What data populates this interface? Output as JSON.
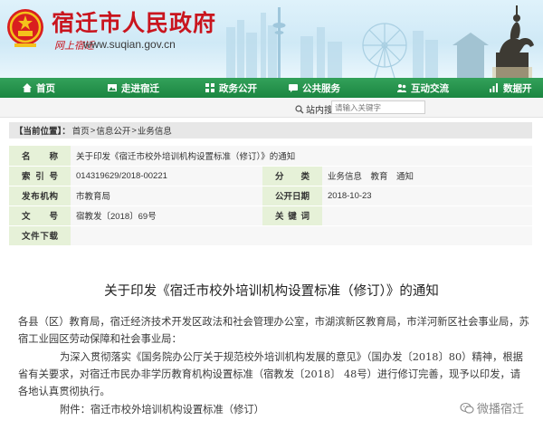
{
  "header": {
    "title": "宿迁市人民政府",
    "seal_text": "网上宿迁",
    "url": "www.suqian.gov.cn"
  },
  "nav": {
    "items": [
      {
        "label": "首页",
        "icon": "house-icon"
      },
      {
        "label": "走进宿迁",
        "icon": "picture-icon"
      },
      {
        "label": "政务公开",
        "icon": "grid-icon"
      },
      {
        "label": "公共服务",
        "icon": "chat-icon"
      },
      {
        "label": "互动交流",
        "icon": "people-icon"
      },
      {
        "label": "数据开",
        "icon": "chart-icon"
      }
    ]
  },
  "search": {
    "label": "站内搜索：",
    "placeholder": "请输入关键字"
  },
  "breadcrumb": {
    "prefix": "【当前位置】：",
    "items": [
      "首页",
      "信息公开",
      "业务信息"
    ],
    "separator": ">"
  },
  "info": {
    "name_label": "名　称",
    "name_value": "关于印发《宿迁市校外培训机构设置标准（修订）》的通知",
    "index_label": "索引号",
    "index_value": "014319629/2018-00221",
    "category_label": "分　类",
    "category_value": "业务信息　教育　通知",
    "org_label": "发布机构",
    "org_value": "市教育局",
    "date_label": "公开日期",
    "date_value": "2018-10-23",
    "doc_label": "文　号",
    "doc_value": "宿教发〔2018〕69号",
    "keyword_label": "关键词",
    "keyword_value": "",
    "download_label": "文件下载",
    "download_value": ""
  },
  "article": {
    "title": "关于印发《宿迁市校外培训机构设置标准（修订）》的通知",
    "para1": "各县（区）教育局，宿迁经济技术开发区政法和社会管理办公室，市湖滨新区教育局，市洋河新区社会事业局，苏宿工业园区劳动保障和社会事业局：",
    "para2": "为深入贯彻落实《国务院办公厅关于规范校外培训机构发展的意见》（国办发〔2018〕80）精神，根据省有关要求，对宿迁市民办非学历教育机构设置标准（宿教发〔2018〕 48号）进行修订完善，现予以印发，请各地认真贯彻执行。",
    "para3": "附件：宿迁市校外培训机构设置标准（修订）"
  },
  "watermark": {
    "text": "微播宿迁"
  },
  "colors": {
    "brand_red": "#c9151e",
    "nav_green": "#1b8641",
    "label_green": "#e6f1d8"
  }
}
